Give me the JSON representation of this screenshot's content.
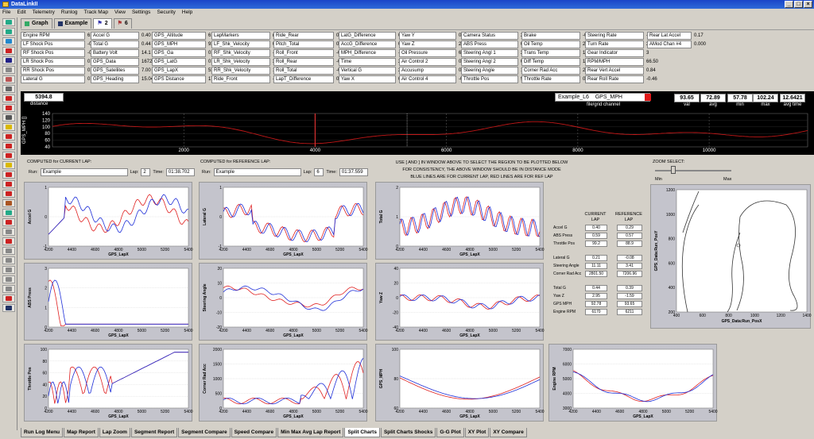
{
  "app": {
    "title": "DataLinkII"
  },
  "menu": [
    "File",
    "Edit",
    "Telemetry",
    "Runlog",
    "Track Map",
    "View",
    "Settings",
    "Security",
    "Help"
  ],
  "tabs": [
    {
      "label": "Graph"
    },
    {
      "label": "Example"
    },
    {
      "label": "2"
    },
    {
      "label": "6"
    }
  ],
  "stats": {
    "col1": [
      [
        "Engine RPM",
        "6170"
      ],
      [
        "LF Shock Pos",
        "-0.08220"
      ],
      [
        "RF Shock Pos",
        "-0.09030"
      ],
      [
        "LR Shock Pos",
        "0.415390"
      ],
      [
        "RR Shock Pos",
        "0.316400"
      ],
      [
        "Lateral G",
        "0.21"
      ]
    ],
    "col2": [
      [
        "Accel G",
        "0.40"
      ],
      [
        "Total G",
        "0.44"
      ],
      [
        "Battery Volt",
        "14.1"
      ],
      [
        "GPS_Data",
        "16725.0"
      ],
      [
        "GPS_Satellites",
        "7.00"
      ],
      [
        "GPS_Heading",
        "15.04"
      ]
    ],
    "col3": [
      [
        "GPS_Altitude",
        "616.52"
      ],
      [
        "GPS_MPH",
        "92.78"
      ],
      [
        "GPS_Ga",
        "0.36"
      ],
      [
        "GPS_LatG",
        "0.21"
      ],
      [
        "GPS_LapX",
        "5397.20"
      ],
      [
        "GPS Distance",
        "17265"
      ]
    ],
    "col4": [
      [
        "LapMarkers",
        "none"
      ],
      [
        "LF_Shk_Velocity",
        "0.00000"
      ],
      [
        "RF_Shk_Velocity",
        "-1.01300"
      ],
      [
        "LR_Shk_Velocity",
        "3.95001"
      ],
      [
        "RR_Shk_Velocity",
        "1.53513"
      ],
      [
        "Ride_Front",
        "-0.08625"
      ]
    ],
    "col5": [
      [
        "Ride_Rear",
        "0.36590"
      ],
      [
        "Pitch_Total",
        "0.45215"
      ],
      [
        "Roll_Front",
        "-0.87"
      ],
      [
        "Roll_Rear",
        "-0.09899"
      ],
      [
        "Roll_Total",
        "-0.05355"
      ],
      [
        "LapT_Difference",
        "0.55"
      ]
    ],
    "col6": [
      [
        "LatG_Difference",
        "0.29"
      ],
      [
        "AccG_Difference",
        "0.01"
      ],
      [
        "MPH_Difference",
        "-0.87"
      ],
      [
        "Time",
        "262.52"
      ],
      [
        "Vertical G",
        "2.00"
      ],
      [
        "Yaw X",
        "0.04"
      ]
    ],
    "col7": [
      [
        "Yaw Y",
        "0.05"
      ],
      [
        "Yaw Z",
        "2.95"
      ],
      [
        "Oil Pressure",
        "64.7"
      ],
      [
        "Air Control 2",
        "0.000"
      ],
      [
        "Accusump",
        "0"
      ],
      [
        "Air Control 4",
        "-0.001"
      ]
    ],
    "col8": [
      [
        "Camera Status",
        "2"
      ],
      [
        "ABS Press",
        "0.59"
      ],
      [
        "Steering Angl 1",
        "2.083"
      ],
      [
        "Steering Angl 2",
        "0.303"
      ],
      [
        "Steering Angle",
        "11.11"
      ],
      [
        "Throttle Pos",
        "99.2"
      ]
    ],
    "col9": [
      [
        "Brake",
        "-0"
      ],
      [
        "Oil Temp",
        "238.8"
      ],
      [
        "Trans Temp",
        "141"
      ],
      [
        "Diff Temp",
        "132"
      ],
      [
        "Corner Rad Acc",
        "2801.50"
      ],
      [
        "Throttle Rate",
        "0.24"
      ]
    ],
    "col10": [
      [
        "Steering Rate",
        "-2.68"
      ],
      [
        "Turn Rate",
        "2.98"
      ],
      [
        "Gear Indicator",
        "3"
      ],
      [
        "RPM/MPH",
        "66.50"
      ],
      [
        "Rear Vert Accel",
        "0.84"
      ],
      [
        "Rear Roll Rate",
        "-0.46"
      ]
    ],
    "col11": [
      [
        "Rear Lat Accel",
        "0.17"
      ],
      [
        "AMod Chan #4",
        "0.000"
      ]
    ]
  },
  "strip": {
    "distance_value": "5394.8",
    "distance_label": "distance",
    "file_channel": "Example_L6",
    "channel_name": "GPS_MPH",
    "file_grid_label": "file/grid channel",
    "readouts": [
      {
        "v": "93.65",
        "l": "val"
      },
      {
        "v": "72.89",
        "l": "avg"
      },
      {
        "v": "57.78",
        "l": "min"
      },
      {
        "v": "102.24",
        "l": "max"
      },
      {
        "v": "12.6421",
        "l": "avg time"
      }
    ],
    "ylabel": "GPS_MPH []",
    "yticks": [
      "140",
      "120",
      "100",
      "80",
      "60",
      "40"
    ],
    "xticks": [
      "2000",
      "4000",
      "6000",
      "8000",
      "10000"
    ]
  },
  "current": {
    "header": "COMPUTED for CURRENT LAP:",
    "run_label": "Run:",
    "run": "Example",
    "lap_label": "Lap:",
    "lap": "2",
    "time_label": "Time:",
    "time": "01:38.702"
  },
  "reference": {
    "header": "COMPUTED for REFERENCE LAP:",
    "run_label": "Run:",
    "run": "Example",
    "lap_label": "Lap:",
    "lap": "6",
    "time_label": "Time:",
    "time": "01:37.559"
  },
  "instructions": [
    "USE [ AND ] IN WINDOW ABOVE TO SELECT THE REGION TO BE PLOTTED BELOW",
    "FOR CONSISTENCY, THE ABOVE WINDOW SHOULD BE IN DISTANCE MODE",
    "BLUE LINES ARE FOR CURRENT LAP, RED LINES ARE FOR REF LAP"
  ],
  "zoom": {
    "label": "ZOOM SELECT:",
    "min": "Min",
    "max": "Max"
  },
  "compare": {
    "hdr_current": "CURRENT LAP",
    "hdr_reference": "REFERENCE LAP",
    "groups": [
      [
        [
          "Accel G",
          "0.40",
          "0.29"
        ],
        [
          "ABS Press",
          "0.59",
          "0.57"
        ],
        [
          "Throttle Pos",
          "99.2",
          "88.9"
        ]
      ],
      [
        [
          "Lateral G",
          "0.21",
          "-0.08"
        ],
        [
          "Steering Angle",
          "11.11",
          "3.41"
        ],
        [
          "Corner Rad Acc",
          "2801.50",
          "7206.96"
        ]
      ],
      [
        [
          "Total G",
          "0.44",
          "0.39"
        ],
        [
          "Yaw Z",
          "2.95",
          "-1.59"
        ],
        [
          "GPS MPH",
          "92.78",
          "93.65"
        ],
        [
          "Engine RPM",
          "6170",
          "6211"
        ]
      ]
    ]
  },
  "plots": [
    {
      "ylabel": "Accel G",
      "xlabel": "GPS_LapX",
      "yticks": [
        "1",
        "0",
        "-1"
      ]
    },
    {
      "ylabel": "Lateral G",
      "xlabel": "GPS_LapX",
      "yticks": [
        "1",
        "0",
        "-1"
      ]
    },
    {
      "ylabel": "Total G",
      "xlabel": "GPS_LapX",
      "yticks": [
        "2",
        "1",
        "0"
      ]
    },
    {
      "ylabel": "ABS Press",
      "xlabel": "GPS_LapX",
      "yticks": [
        "3",
        "2",
        "1",
        "0"
      ]
    },
    {
      "ylabel": "Steering Angle",
      "xlabel": "GPS_LapX",
      "yticks": [
        "20",
        "10",
        "0",
        "-10",
        "-20"
      ]
    },
    {
      "ylabel": "Yaw Z",
      "xlabel": "GPS_LapX",
      "yticks": [
        "40",
        "20",
        "0",
        "-20",
        "-40"
      ]
    },
    {
      "ylabel": "Throttle Pos",
      "xlabel": "GPS_LapX",
      "yticks": [
        "100",
        "80",
        "60",
        "40",
        "20",
        "0"
      ]
    },
    {
      "ylabel": "Corner Rad Acc",
      "xlabel": "GPS_LapX",
      "yticks": [
        "2000",
        "1500",
        "1000",
        "500",
        "0"
      ]
    },
    {
      "ylabel": "GPS_MPH",
      "xlabel": "GPS_LapX",
      "yticks": [
        "100",
        "80",
        "60"
      ]
    },
    {
      "ylabel": "Engine RPM",
      "xlabel": "GPS_LapX",
      "yticks": [
        "7000",
        "6000",
        "5000",
        "4000",
        "3000"
      ]
    }
  ],
  "plot_xticks": [
    "4200",
    "4400",
    "4600",
    "4800",
    "5000",
    "5200",
    "5400"
  ],
  "trackmap": {
    "ylabel": "GPS_Data:Run_PosY",
    "xlabel": "GPS_Data:Run_PosX",
    "yticks": [
      "1200",
      "1000",
      "800",
      "600",
      "400",
      "200"
    ],
    "xticks": [
      "400",
      "600",
      "800",
      "1000",
      "1200",
      "1400"
    ]
  },
  "bottom_tabs": [
    "Run Log Menu",
    "Map Report",
    "Lap Zoom",
    "Segment Report",
    "Segment Compare",
    "Speed Compare",
    "Min Max Avg Lap Report",
    "Split Charts",
    "Split Charts Shocks",
    "G-G Plot",
    "XY Plot",
    "XY Compare"
  ],
  "colors": {
    "current": "#1f2fd8",
    "reference": "#e02020",
    "strip_line": "#c01818",
    "marker": "#d83030"
  }
}
